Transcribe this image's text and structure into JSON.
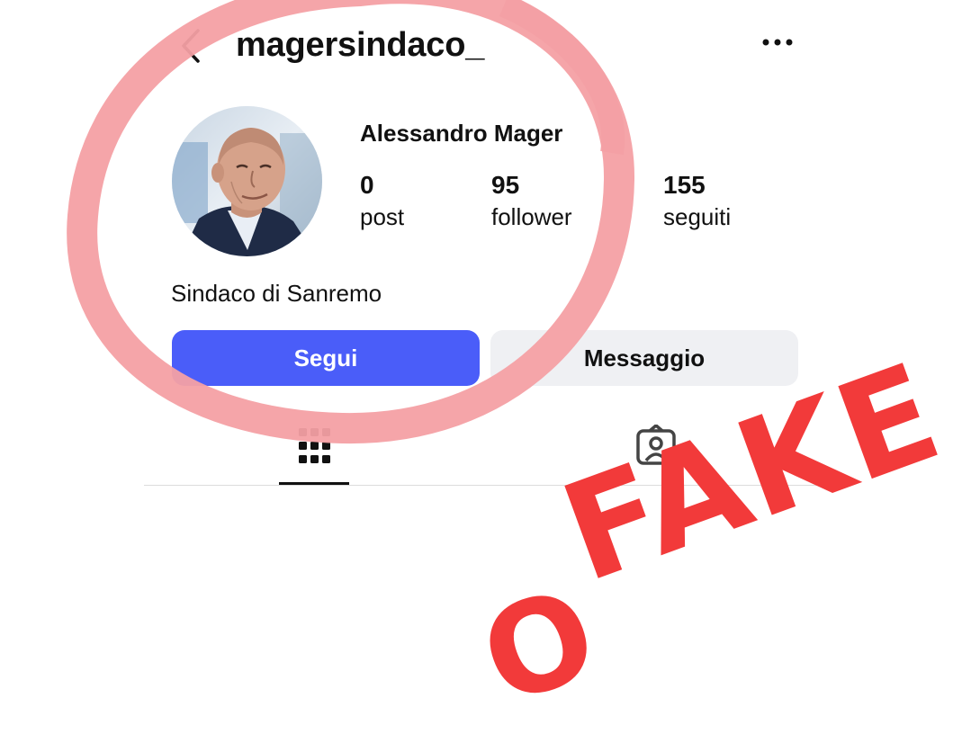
{
  "header": {
    "username": "magersindaco_",
    "back_icon": "chevron-left-icon",
    "more_icon": "more-horizontal-icon"
  },
  "profile": {
    "full_name": "Alessandro Mager",
    "avatar_icon": "profile-photo",
    "stats": [
      {
        "value": "0",
        "label": "post"
      },
      {
        "value": "95",
        "label": "follower"
      },
      {
        "value": "155",
        "label": "seguiti"
      }
    ],
    "bio": "Sindaco di Sanremo"
  },
  "actions": {
    "follow_label": "Segui",
    "message_label": "Messaggio"
  },
  "tabs": [
    {
      "icon": "grid-icon",
      "active": true
    },
    {
      "icon": "tagged-person-icon",
      "active": false
    }
  ],
  "overlay": {
    "stamp_text": "FAKE",
    "stamp_partial": "O",
    "colors": {
      "circle": "#f4a0a4",
      "stamp": "#f23a3a",
      "follow_button": "#4a5df9",
      "message_button": "#eff0f3"
    }
  }
}
